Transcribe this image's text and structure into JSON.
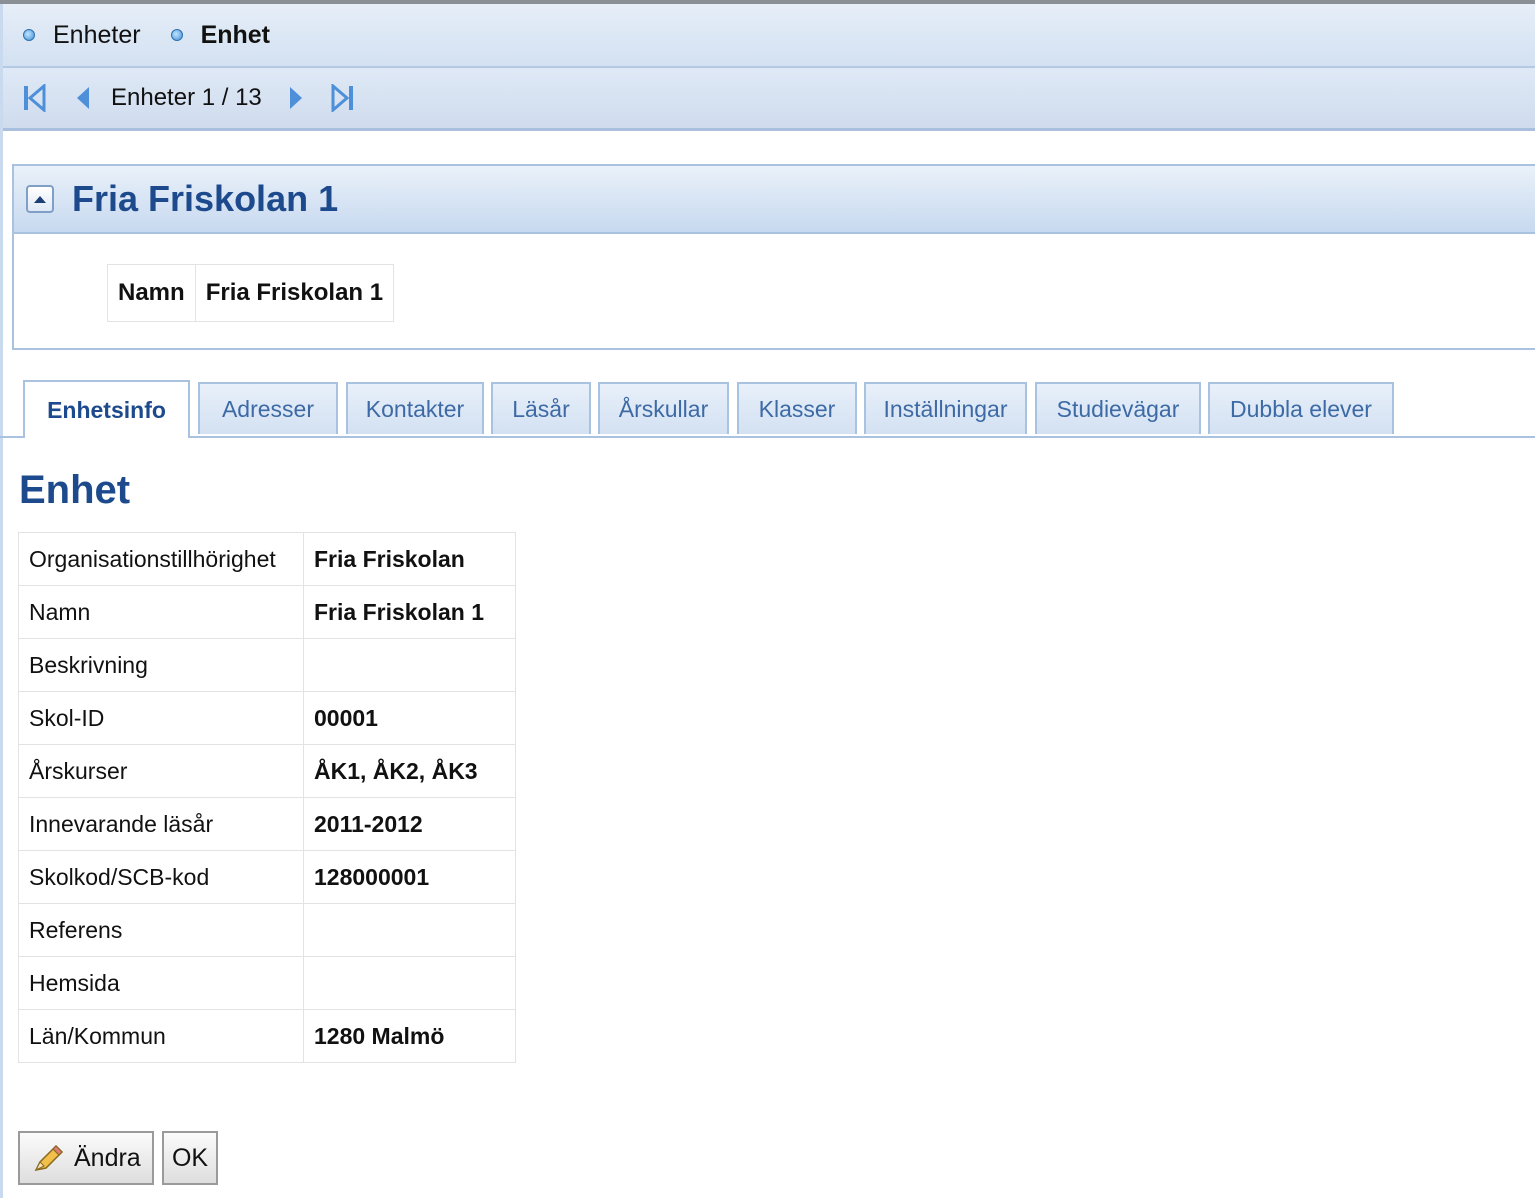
{
  "breadcrumb": {
    "items": [
      {
        "label": "Enheter"
      },
      {
        "label": "Enhet"
      }
    ]
  },
  "pager": {
    "text": "Enheter 1 / 13",
    "first_icon": "first-page-icon",
    "prev_icon": "prev-page-icon",
    "next_icon": "next-page-icon",
    "last_icon": "last-page-icon"
  },
  "section": {
    "title": "Fria Friskolan 1",
    "collapse_icon": "collapse-up-icon",
    "name_label": "Namn",
    "name_value": "Fria Friskolan 1"
  },
  "tabs": [
    {
      "label": "Enhetsinfo",
      "active": true
    },
    {
      "label": "Adresser"
    },
    {
      "label": "Kontakter"
    },
    {
      "label": "Läsår"
    },
    {
      "label": "Årskullar"
    },
    {
      "label": "Klasser"
    },
    {
      "label": "Inställningar"
    },
    {
      "label": "Studievägar"
    },
    {
      "label": "Dubbla elever"
    }
  ],
  "main": {
    "heading": "Enhet",
    "rows": [
      {
        "label": "Organisationstillhörighet",
        "value": "Fria Friskolan"
      },
      {
        "label": "Namn",
        "value": "Fria Friskolan 1"
      },
      {
        "label": "Beskrivning",
        "value": ""
      },
      {
        "label": "Skol-ID",
        "value": "00001"
      },
      {
        "label": "Årskurser",
        "value": "ÅK1, ÅK2, ÅK3"
      },
      {
        "label": "Innevarande läsår",
        "value": "2011-2012"
      },
      {
        "label": "Skolkod/SCB-kod",
        "value": "128000001"
      },
      {
        "label": "Referens",
        "value": ""
      },
      {
        "label": "Hemsida",
        "value": ""
      },
      {
        "label": "Län/Kommun",
        "value": "1280 Malmö"
      }
    ]
  },
  "buttons": {
    "edit_label": "Ändra",
    "edit_icon": "pencil-icon",
    "ok_label": "OK"
  },
  "colors": {
    "accent_text": "#1d4a8c",
    "tab_text": "#3d6aa5",
    "bar_border": "#a9c2e0"
  }
}
